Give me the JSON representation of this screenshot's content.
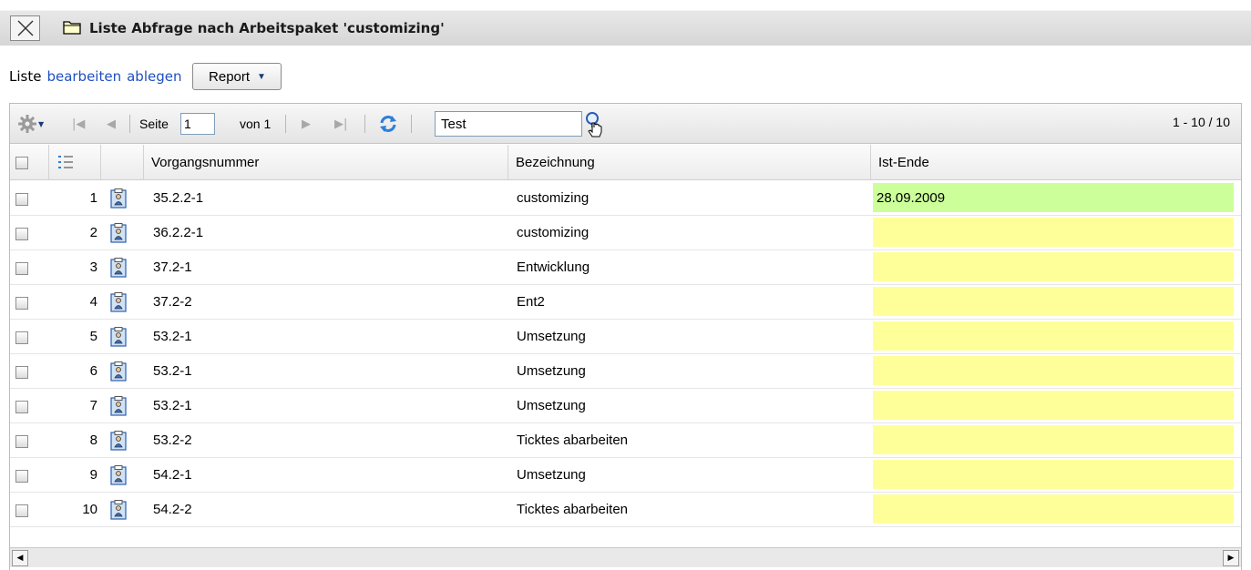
{
  "title": "Liste Abfrage nach Arbeitspaket 'customizing'",
  "actions": {
    "label": "Liste",
    "edit": "bearbeiten",
    "file": "ablegen",
    "report": "Report"
  },
  "pager": {
    "page_label": "Seite",
    "page_value": "1",
    "of_label": "von 1",
    "search_value": "Test",
    "info": "1 - 10 / 10"
  },
  "columns": [
    "Vorgangsnummer",
    "Bezeichnung",
    "Ist-Ende"
  ],
  "colors": {
    "green": "#ccff99",
    "yellow": "#ffff99"
  },
  "rows": [
    {
      "num": "1",
      "vorgang": "35.2.2-1",
      "bez": "customizing",
      "ist": "28.09.2009",
      "status": "green"
    },
    {
      "num": "2",
      "vorgang": "36.2.2-1",
      "bez": "customizing",
      "ist": "",
      "status": "yellow"
    },
    {
      "num": "3",
      "vorgang": "37.2-1",
      "bez": "Entwicklung",
      "ist": "",
      "status": "yellow"
    },
    {
      "num": "4",
      "vorgang": "37.2-2",
      "bez": "Ent2",
      "ist": "",
      "status": "yellow"
    },
    {
      "num": "5",
      "vorgang": "53.2-1",
      "bez": "Umsetzung",
      "ist": "",
      "status": "yellow"
    },
    {
      "num": "6",
      "vorgang": "53.2-1",
      "bez": "Umsetzung",
      "ist": "",
      "status": "yellow"
    },
    {
      "num": "7",
      "vorgang": "53.2-1",
      "bez": "Umsetzung",
      "ist": "",
      "status": "yellow"
    },
    {
      "num": "8",
      "vorgang": "53.2-2",
      "bez": "Ticktes abarbeiten",
      "ist": "",
      "status": "yellow"
    },
    {
      "num": "9",
      "vorgang": "54.2-1",
      "bez": "Umsetzung",
      "ist": "",
      "status": "yellow"
    },
    {
      "num": "10",
      "vorgang": "54.2-2",
      "bez": "Ticktes abarbeiten",
      "ist": "",
      "status": "yellow"
    }
  ]
}
